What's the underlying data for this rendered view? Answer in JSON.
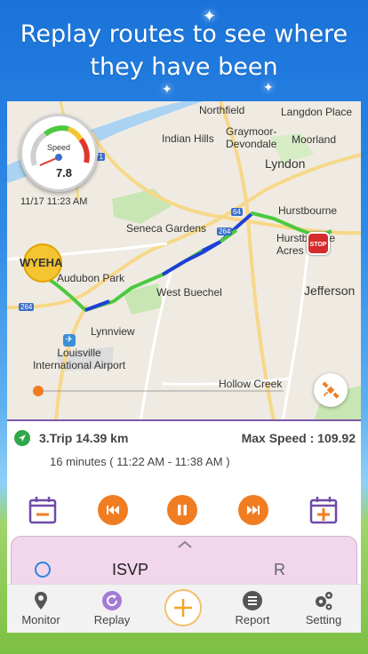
{
  "headline": {
    "line1": "Replay routes to see where",
    "line2": "they have been"
  },
  "map": {
    "places": [
      {
        "key": "northfield",
        "text": "Northfield"
      },
      {
        "key": "langdon",
        "text": "Langdon Place"
      },
      {
        "key": "indianhills",
        "text": "Indian Hills"
      },
      {
        "key": "graymoor",
        "text": "Graymoor-\nDevondale"
      },
      {
        "key": "moorland",
        "text": "Moorland"
      },
      {
        "key": "lyndon",
        "text": "Lyndon"
      },
      {
        "key": "hurstbourne",
        "text": "Hurstbourne"
      },
      {
        "key": "hurstacres",
        "text": "Hurstbourne\nAcres"
      },
      {
        "key": "seneca",
        "text": "Seneca Gardens"
      },
      {
        "key": "audubon",
        "text": "Audubon Park"
      },
      {
        "key": "westbuechel",
        "text": "West Buechel"
      },
      {
        "key": "jefferson",
        "text": "Jefferson"
      },
      {
        "key": "lynnview",
        "text": "Lynnview"
      },
      {
        "key": "airport",
        "text": "Louisville\nInternational Airport"
      },
      {
        "key": "hollowcreek",
        "text": "Hollow Creek"
      }
    ],
    "route_shields": [
      "71",
      "64",
      "264",
      "264"
    ],
    "speedometer": {
      "label": "Speed",
      "value": "7.8"
    },
    "timestamp": "11/17 11:23 AM",
    "start_marker": "WYEHA",
    "end_marker": "STOP"
  },
  "trip": {
    "title": "3.Trip 14.39 km",
    "max_speed": "Max Speed : 109.92",
    "duration": "16 minutes ( 11:22 AM - 11:38 AM )"
  },
  "drawer": {
    "device": "ISVP",
    "right_text": "R"
  },
  "tabs": [
    {
      "key": "monitor",
      "label": "Monitor",
      "icon": "location-pin-icon"
    },
    {
      "key": "replay",
      "label": "Replay",
      "icon": "replay-icon"
    },
    {
      "key": "report",
      "label": "Report",
      "icon": "list-icon"
    },
    {
      "key": "setting",
      "label": "Setting",
      "icon": "gears-icon"
    }
  ],
  "colors": {
    "accent_orange": "#f07d22",
    "accent_purple": "#7d5ba6",
    "route_green": "#4cc93f",
    "route_blue": "#1e3fd6",
    "drawer_pink": "#f2d6ec"
  }
}
